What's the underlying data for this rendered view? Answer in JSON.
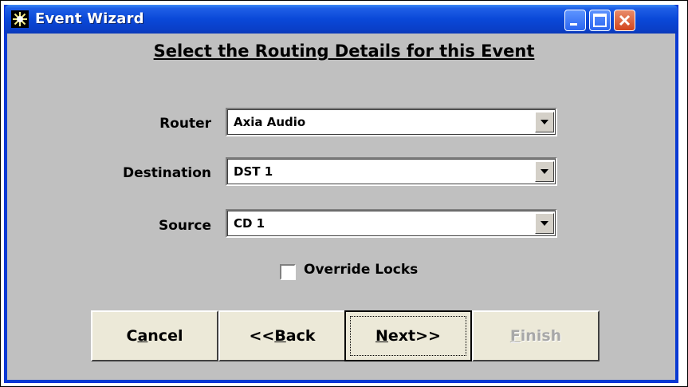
{
  "window": {
    "title": "Event Wizard",
    "icon": "starburst-icon"
  },
  "title_buttons": {
    "minimize_icon": "minimize-icon",
    "maximize_icon": "maximize-icon",
    "close_icon": "close-icon"
  },
  "heading": "Select the Routing Details for this Event",
  "fields": {
    "router": {
      "label": "Router",
      "value": "Axia Audio"
    },
    "destination": {
      "label": "Destination",
      "value": "DST 1"
    },
    "source": {
      "label": "Source",
      "value": "CD 1"
    }
  },
  "override_locks": {
    "label": "Override Locks",
    "checked": false
  },
  "buttons": {
    "cancel": {
      "pre": "C",
      "accel": "a",
      "post": "ncel"
    },
    "back": {
      "pre": "<<",
      "accel": "B",
      "post": "ack"
    },
    "next": {
      "pre": "",
      "accel": "N",
      "post": "ext>>"
    },
    "finish": {
      "pre": "",
      "accel": "F",
      "post": "inish",
      "disabled": true
    }
  },
  "colors": {
    "titlebar": "#0a48d8",
    "client_background": "#c0c0c0",
    "button_face": "#ece9d8",
    "close_button": "#d2451e"
  }
}
